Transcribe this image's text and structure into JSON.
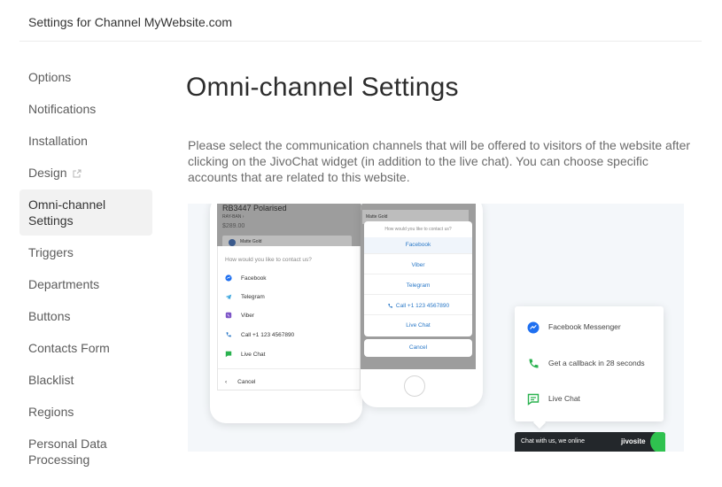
{
  "header": {
    "title": "Settings for Channel MyWebsite.com"
  },
  "sidebar": {
    "items": [
      {
        "label": "Options"
      },
      {
        "label": "Notifications"
      },
      {
        "label": "Installation"
      },
      {
        "label": "Design"
      },
      {
        "label": "Omni-channel Settings"
      },
      {
        "label": "Triggers"
      },
      {
        "label": "Departments"
      },
      {
        "label": "Buttons"
      },
      {
        "label": "Contacts Form"
      },
      {
        "label": "Blacklist"
      },
      {
        "label": "Regions"
      },
      {
        "label": "Personal Data Processing"
      }
    ],
    "active": "Omni-channel Settings"
  },
  "main": {
    "title": "Omni-channel Settings",
    "description": "Please select the communication channels that will be offered to visitors of the website after clicking on the JivoChat widget (in addition to the live chat). You can choose specific accounts that are related to this website."
  },
  "illustration": {
    "phone1": {
      "product": "RB3447 Polarised",
      "brand": "RAY-BAN ›",
      "price": "$289.00",
      "swatch": "Matte Gold",
      "question": "How would you like to contact us?",
      "options": [
        "Facebook",
        "Telegram",
        "Viber",
        "Call +1 123 4567890",
        "Live Chat"
      ],
      "cancel": "Cancel"
    },
    "phone2": {
      "header": "Matte Gold",
      "question": "How would you like to contact us?",
      "options": [
        "Facebook",
        "Viber",
        "Telegram",
        "Call +1 123 4567890",
        "Live Chat"
      ],
      "cancel": "Cancel"
    },
    "popup": {
      "items": [
        "Facebook Messenger",
        "Get a callback in 28 seconds",
        "Live Chat"
      ]
    },
    "chatbar": {
      "text": "Chat with us, we online",
      "logo": "jivosite"
    }
  },
  "colors": {
    "messenger": "#1e6ff0",
    "phone": "#2ab24f",
    "telegram": "#37a4dd",
    "viber": "#7d55c7",
    "link": "#2a78c7",
    "chatbar": "#23272b",
    "chatbar_accent": "#2fc24f"
  }
}
